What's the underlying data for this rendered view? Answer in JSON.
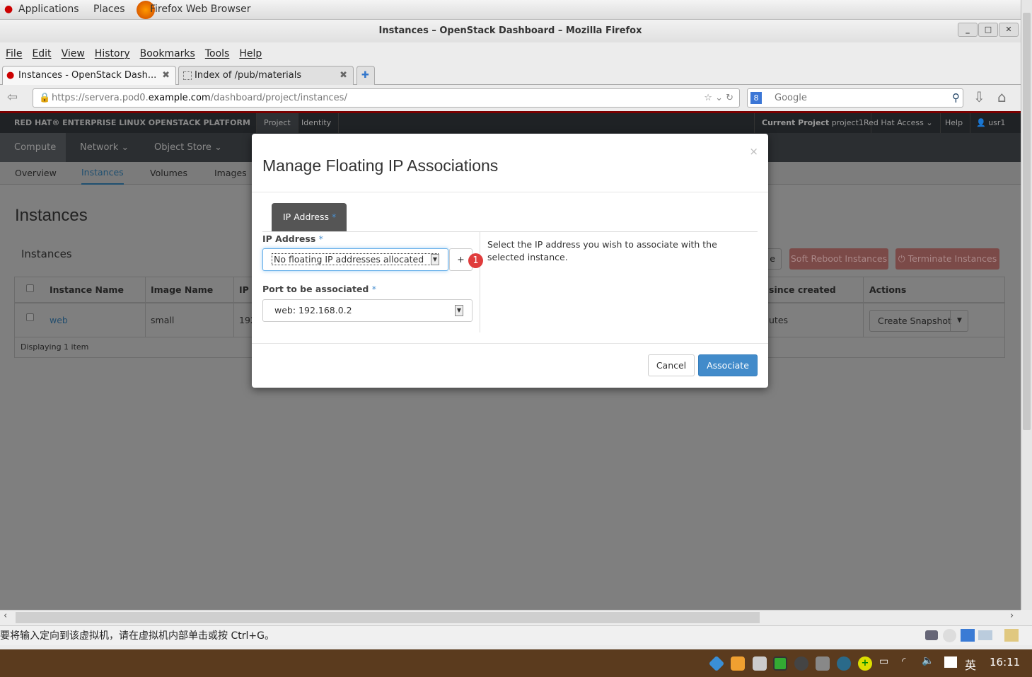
{
  "gnome": {
    "applications": "Applications",
    "places": "Places",
    "app": "Firefox Web Browser"
  },
  "window": {
    "title": "Instances – OpenStack Dashboard – Mozilla Firefox"
  },
  "menu": [
    "File",
    "Edit",
    "View",
    "History",
    "Bookmarks",
    "Tools",
    "Help"
  ],
  "tabs": [
    {
      "label": "Instances - OpenStack Dash..."
    },
    {
      "label": "Index of /pub/materials"
    }
  ],
  "nav": {
    "url_prefix": "https://servera.pod0.",
    "url_domain": "example.com",
    "url_path": "/dashboard/project/instances/",
    "search_placeholder": "Google"
  },
  "header": {
    "brand": "RED HAT® ENTERPRISE LINUX OPENSTACK PLATFORM",
    "project": "Project",
    "identity": "Identity",
    "current_project_label": "Current Project",
    "current_project": "project1",
    "redhat_access": "Red Hat Access",
    "help": "Help",
    "user": "usr1"
  },
  "subnav": {
    "compute": "Compute",
    "network": "Network",
    "object_store": "Object Store"
  },
  "panels": [
    "Overview",
    "Instances",
    "Volumes",
    "Images"
  ],
  "page": {
    "title": "Instances",
    "table_title": "Instances",
    "soft_reboot": "Soft Reboot Instances",
    "terminate": "Terminate Instances",
    "partial_btn": "e",
    "columns": [
      "Instance Name",
      "Image Name",
      "IP",
      "since created",
      "Actions"
    ],
    "rows": [
      {
        "name": "web",
        "image": "small",
        "ip": "192",
        "age": "utes",
        "action": "Create Snapshot"
      }
    ],
    "footer": "Displaying 1 item"
  },
  "modal": {
    "title": "Manage Floating IP Associations",
    "close": "×",
    "tab": "IP Address",
    "ip_label": "IP Address",
    "ip_value": "No floating IP addresses allocated",
    "add": "+",
    "badge": "1",
    "port_label": "Port to be associated",
    "port_value": "web: 192.168.0.2",
    "required": "*",
    "help": "Select the IP address you wish to associate with the selected instance.",
    "cancel": "Cancel",
    "associate": "Associate"
  },
  "status": {
    "text": "要将输入定向到该虚拟机，请在虚拟机内部单击或按 Ctrl+G。"
  },
  "taskbar": {
    "ime": "英",
    "time": "16:11"
  },
  "colors": {
    "primary": "#428bca",
    "danger": "#d9534f",
    "badge": "#e03c3c"
  }
}
